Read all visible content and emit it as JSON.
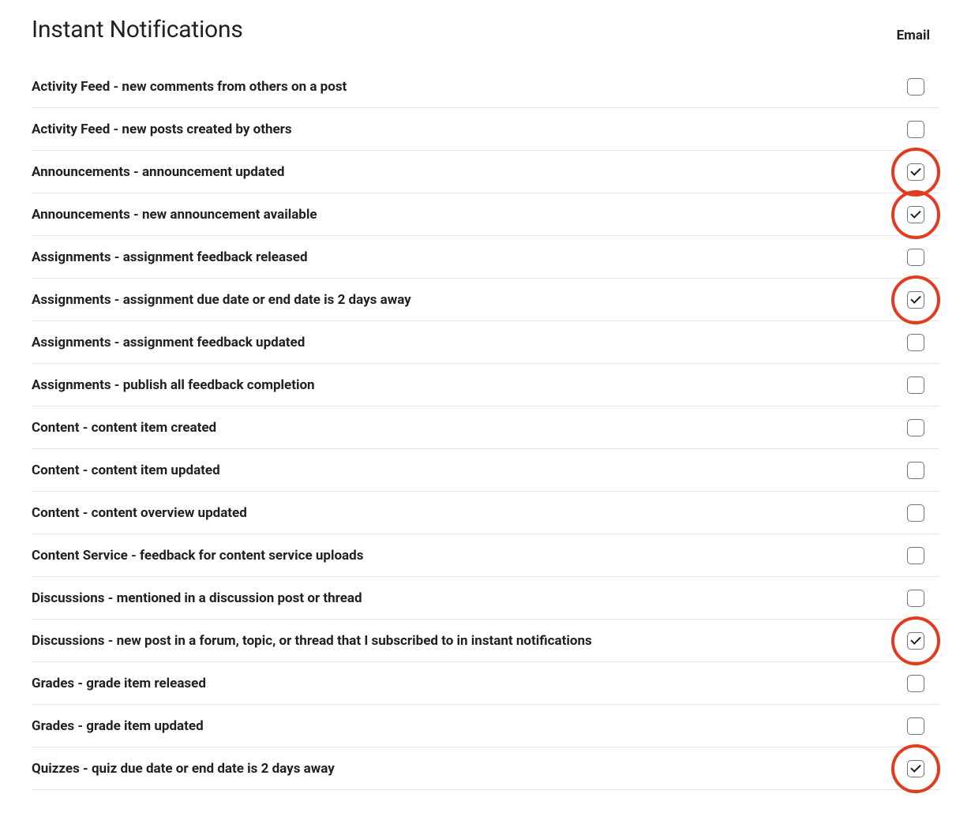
{
  "section_title": "Instant Notifications",
  "column_header": "Email",
  "notifications": [
    {
      "label": "Activity Feed - new comments from others on a post",
      "checked": false,
      "highlighted": false
    },
    {
      "label": "Activity Feed - new posts created by others",
      "checked": false,
      "highlighted": false
    },
    {
      "label": "Announcements - announcement updated",
      "checked": true,
      "highlighted": true
    },
    {
      "label": "Announcements - new announcement available",
      "checked": true,
      "highlighted": true
    },
    {
      "label": "Assignments - assignment feedback released",
      "checked": false,
      "highlighted": false
    },
    {
      "label": "Assignments - assignment due date or end date is 2 days away",
      "checked": true,
      "highlighted": true
    },
    {
      "label": "Assignments - assignment feedback updated",
      "checked": false,
      "highlighted": false
    },
    {
      "label": "Assignments - publish all feedback completion",
      "checked": false,
      "highlighted": false
    },
    {
      "label": "Content - content item created",
      "checked": false,
      "highlighted": false
    },
    {
      "label": "Content - content item updated",
      "checked": false,
      "highlighted": false
    },
    {
      "label": "Content - content overview updated",
      "checked": false,
      "highlighted": false
    },
    {
      "label": "Content Service - feedback for content service uploads",
      "checked": false,
      "highlighted": false
    },
    {
      "label": "Discussions - mentioned in a discussion post or thread",
      "checked": false,
      "highlighted": false
    },
    {
      "label": "Discussions - new post in a forum, topic, or thread that I subscribed to in instant notifications",
      "checked": true,
      "highlighted": true
    },
    {
      "label": "Grades - grade item released",
      "checked": false,
      "highlighted": false
    },
    {
      "label": "Grades - grade item updated",
      "checked": false,
      "highlighted": false
    },
    {
      "label": "Quizzes - quiz due date or end date is 2 days away",
      "checked": true,
      "highlighted": true
    }
  ]
}
